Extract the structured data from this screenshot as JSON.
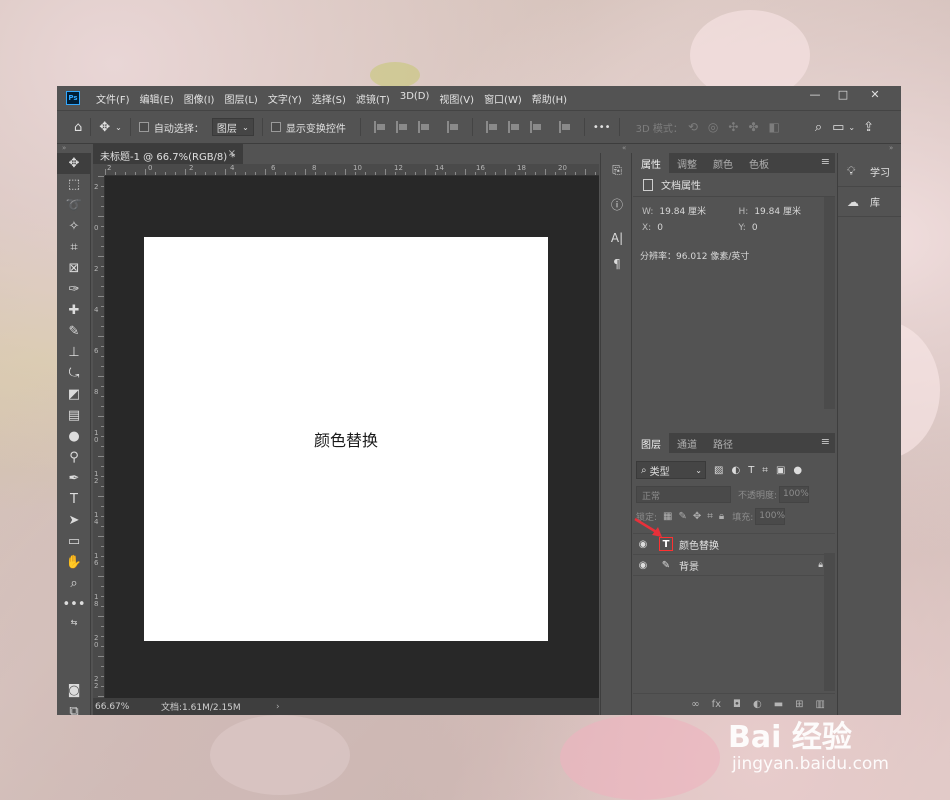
{
  "app": {
    "logo_text": "Ps",
    "menu": [
      "文件(F)",
      "编辑(E)",
      "图像(I)",
      "图层(L)",
      "文字(Y)",
      "选择(S)",
      "滤镜(T)",
      "3D(D)",
      "视图(V)",
      "窗口(W)",
      "帮助(H)"
    ],
    "window_controls": [
      "—",
      "□",
      "✕"
    ]
  },
  "options_bar": {
    "auto_select_label": "自动选择：",
    "auto_select_value": "图层",
    "show_transform_label": "显示变换控件",
    "more": "•••",
    "mode_3d_label": "3D 模式："
  },
  "document": {
    "tab_title": "未标题-1 @ 66.7%(RGB/8) *",
    "close": "×",
    "canvas_text": "颜色替换",
    "ruler_h": [
      "2",
      "0",
      "2",
      "4",
      "6",
      "8",
      "10",
      "12",
      "14",
      "16",
      "18",
      "20"
    ],
    "ruler_v": [
      "2",
      "0",
      "2",
      "4",
      "6",
      "8",
      "1 0",
      "1 2",
      "1 4",
      "1 6",
      "1 8",
      "2 0",
      "2 2"
    ]
  },
  "status": {
    "zoom": "66.67%",
    "doc_size": "文档:1.61M/2.15M",
    "arrow": "›"
  },
  "properties": {
    "tabs": [
      "属性",
      "调整",
      "颜色",
      "色板"
    ],
    "header": "文档属性",
    "w_label": "W:",
    "w_value": "19.84 厘米",
    "h_label": "H:",
    "h_value": "19.84 厘米",
    "x_label": "X:",
    "x_value": "0",
    "y_label": "Y:",
    "y_value": "0",
    "resolution": "分辨率：96.012 像素/英寸"
  },
  "layers": {
    "tabs": [
      "图层",
      "通道",
      "路径"
    ],
    "filter_kind": "类型",
    "blend_mode": "正常",
    "opacity_label": "不透明度:",
    "opacity_value": "100%",
    "lock_label": "锁定:",
    "fill_label": "填充:",
    "fill_value": "100%",
    "items": [
      {
        "name": "颜色替换",
        "thumb": "T",
        "selected": true
      },
      {
        "name": "背景",
        "thumb": "brush",
        "locked": true
      }
    ]
  },
  "far_panel": {
    "learn": "学习",
    "library": "库"
  },
  "watermark": {
    "logo": "Bai  经验",
    "url": "jingyan.baidu.com"
  },
  "colors": {
    "panel_bg": "#535353",
    "canvas_bg": "#282828",
    "foreground_swatch": "#1a1a1a",
    "background_swatch": "#f4ecd9",
    "selected_layer_outline": "#ff3131",
    "arrow": "#e8303a"
  }
}
